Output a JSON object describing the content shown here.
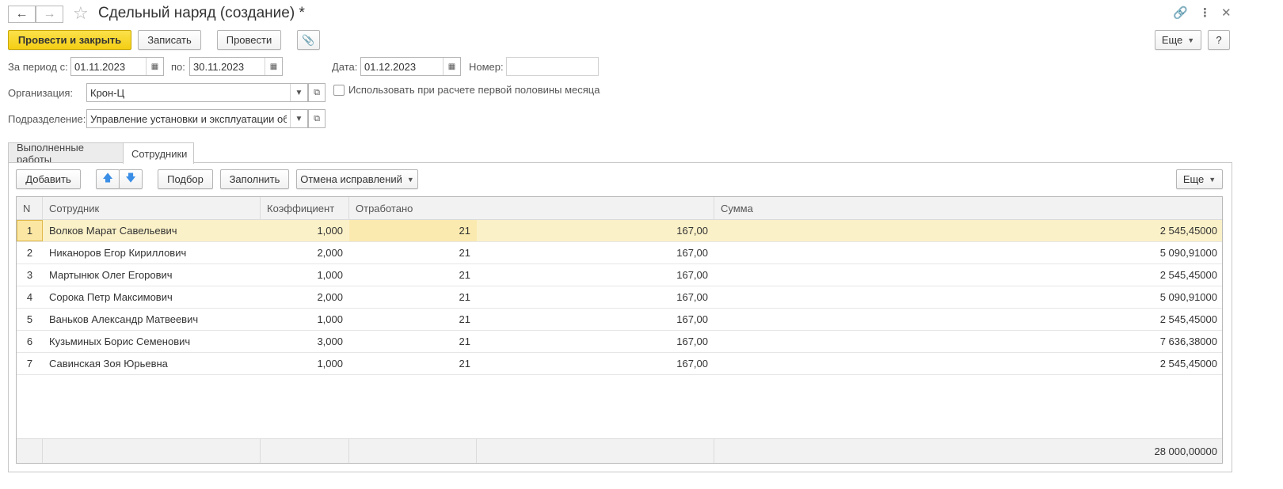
{
  "window": {
    "title": "Сдельный наряд (создание) *"
  },
  "toolbar": {
    "post_close": "Провести и закрыть",
    "save": "Записать",
    "post": "Провести",
    "more": "Еще",
    "help": "?"
  },
  "form": {
    "period_from_label": "За период с:",
    "period_from": "01.11.2023",
    "period_to_label": "по:",
    "period_to": "30.11.2023",
    "date_label": "Дата:",
    "date": "01.12.2023",
    "number_label": "Номер:",
    "number": "",
    "org_label": "Организация:",
    "org": "Крон-Ц",
    "first_half_label": "Использовать при расчете первой половины месяца",
    "dept_label": "Подразделение:",
    "dept": "Управление установки и эксплуатации оборудования"
  },
  "tabs": [
    {
      "label": "Выполненные работы",
      "active": false
    },
    {
      "label": "Сотрудники",
      "active": true
    }
  ],
  "tab_toolbar": {
    "add": "Добавить",
    "pick": "Подбор",
    "fill": "Заполнить",
    "cancel_fixes": "Отмена исправлений",
    "more": "Еще"
  },
  "table": {
    "columns": [
      "N",
      "Сотрудник",
      "Коэффициент",
      "Отработано",
      "",
      "Сумма"
    ],
    "rows": [
      {
        "n": "1",
        "name": "Волков Марат Савельевич",
        "coef": "1,000",
        "days": "21",
        "hours": "167,00",
        "sum": "2 545,45000"
      },
      {
        "n": "2",
        "name": "Никаноров Егор Кириллович",
        "coef": "2,000",
        "days": "21",
        "hours": "167,00",
        "sum": "5 090,91000"
      },
      {
        "n": "3",
        "name": "Мартынюк Олег Егорович",
        "coef": "1,000",
        "days": "21",
        "hours": "167,00",
        "sum": "2 545,45000"
      },
      {
        "n": "4",
        "name": "Сорока Петр Максимович",
        "coef": "2,000",
        "days": "21",
        "hours": "167,00",
        "sum": "5 090,91000"
      },
      {
        "n": "5",
        "name": "Ваньков Александр Матвеевич",
        "coef": "1,000",
        "days": "21",
        "hours": "167,00",
        "sum": "2 545,45000"
      },
      {
        "n": "6",
        "name": "Кузьминых Борис Семенович",
        "coef": "3,000",
        "days": "21",
        "hours": "167,00",
        "sum": "7 636,38000"
      },
      {
        "n": "7",
        "name": "Савинская Зоя Юрьевна",
        "coef": "1,000",
        "days": "21",
        "hours": "167,00",
        "sum": "2 545,45000"
      }
    ],
    "total_sum": "28 000,00000"
  },
  "colors": {
    "primary": "#f4ce14",
    "selected_row": "#fbf1c8"
  }
}
